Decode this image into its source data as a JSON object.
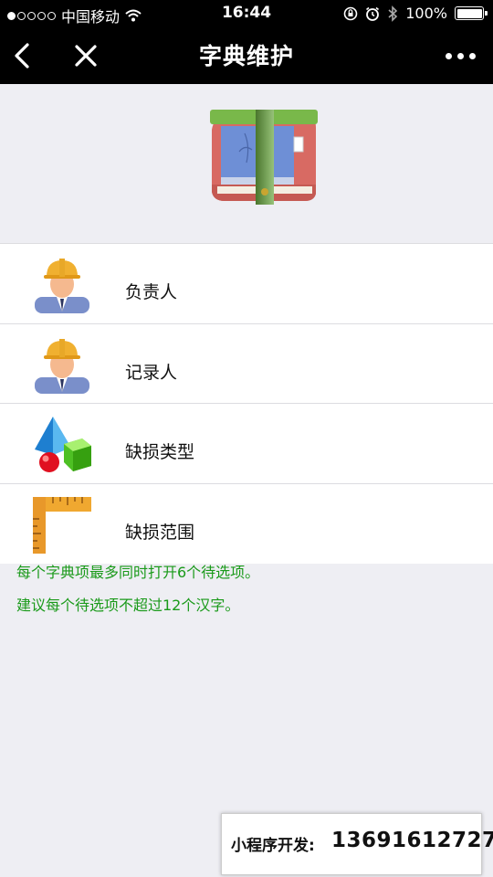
{
  "status_bar": {
    "carrier": "中国移动",
    "time": "16:44",
    "battery": "100%"
  },
  "navbar": {
    "title": "字典维护",
    "back_icon": "chevron-left-icon",
    "close_icon": "close-icon",
    "more_icon": "more-icon"
  },
  "items": [
    {
      "label": "负责人",
      "icon": "worker-icon"
    },
    {
      "label": "记录人",
      "icon": "worker-icon"
    },
    {
      "label": "缺损类型",
      "icon": "shapes-icon"
    },
    {
      "label": "缺损范围",
      "icon": "ruler-icon"
    }
  ],
  "tips": [
    "每个字典项最多同时打开6个待选项。",
    "建议每个待选项不超过12个汉字。"
  ],
  "promo": {
    "label": "小程序开发:",
    "phone": "13691612727"
  },
  "colors": {
    "nav_bg": "#000000",
    "page_bg": "#eeeef3",
    "tip_green": "#1a9a1a"
  }
}
